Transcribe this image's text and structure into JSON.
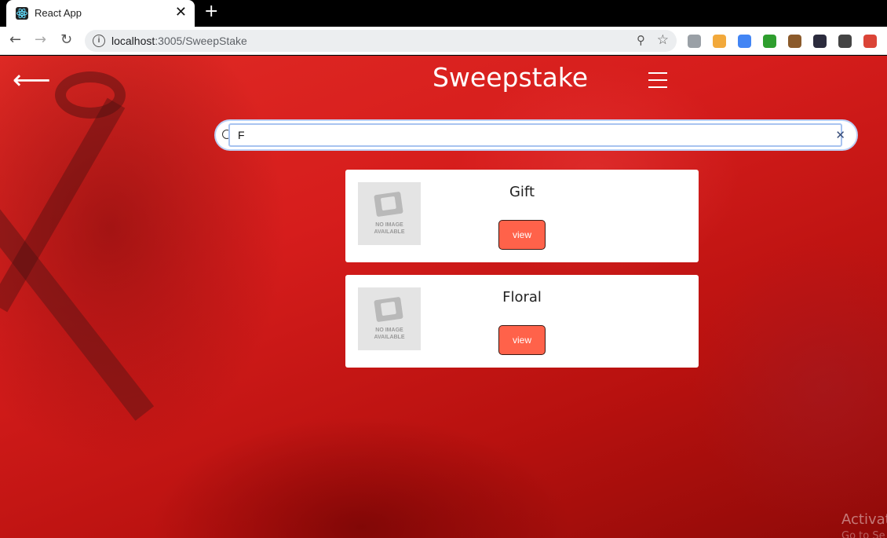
{
  "browser": {
    "tab_title": "React App",
    "tab_close": "✕",
    "new_tab": "+",
    "url_host": "localhost",
    "url_rest": ":3005/SweepStake",
    "extensions": [
      {
        "name": "profile-extension-icon",
        "color": "#9aa0a6"
      },
      {
        "name": "person-check-extension-icon",
        "color": "#f2a93b"
      },
      {
        "name": "check-circle-extension-icon",
        "color": "#4285f4"
      },
      {
        "name": "bw-extension-icon",
        "color": "#2e9e2e"
      },
      {
        "name": "cookie-extension-icon",
        "color": "#8b5a2b"
      },
      {
        "name": "k-extension-icon",
        "color": "#2b2b3d"
      },
      {
        "name": "m-extension-icon",
        "color": "#444444"
      },
      {
        "name": "color-ring-extension-icon",
        "color": "#db4437"
      }
    ]
  },
  "header": {
    "back_icon": "⟵",
    "title": "Sweepstake"
  },
  "search": {
    "value": "F",
    "clear_icon": "✕"
  },
  "cards": [
    {
      "title": "Gift",
      "image_text_1": "NO IMAGE",
      "image_text_2": "AVAILABLE",
      "button_label": "view"
    },
    {
      "title": "Floral",
      "image_text_1": "NO IMAGE",
      "image_text_2": "AVAILABLE",
      "button_label": "view"
    }
  ],
  "watermark": {
    "line1": "Activat",
    "line2": "Go to Se"
  },
  "colors": {
    "background_red": "#d61d1c",
    "button": "#ff624a",
    "card": "#ffffff"
  }
}
